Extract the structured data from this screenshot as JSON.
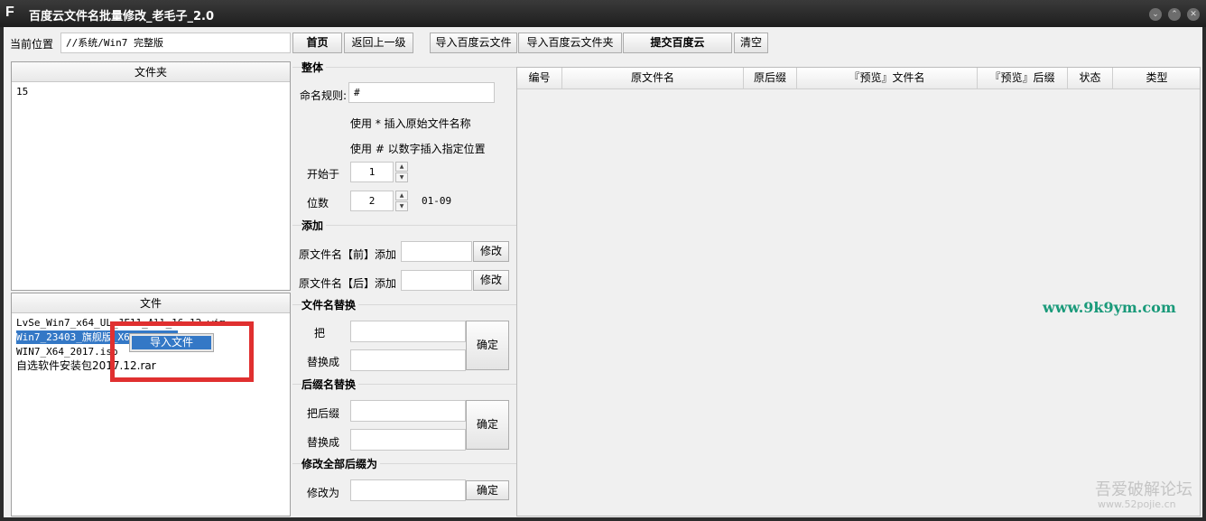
{
  "window": {
    "title": "百度云文件名批量修改_老毛子_2.0",
    "icon": "F",
    "controls": [
      "minimize",
      "maximize",
      "close"
    ]
  },
  "toolbar": {
    "location_label": "当前位置",
    "location_value": "//系统/Win7 完整版",
    "home": "首页",
    "up": "返回上一级",
    "import_file": "导入百度云文件",
    "import_folder": "导入百度云文件夹",
    "submit": "提交百度云",
    "clear": "清空"
  },
  "folders": {
    "header": "文件夹",
    "items": [
      "15"
    ]
  },
  "files": {
    "header": "文件",
    "items": [
      "LvSe_Win7_x64_UL_JF11_All_16.12.wim",
      "Win7_23403_旗舰版_X64_CN.esd",
      "WIN7_X64_2017.iso",
      "自选软件安装包2017.12.rar"
    ],
    "selected_index": 1,
    "context_menu": "导入文件"
  },
  "overall": {
    "title": "整体",
    "rule_label": "命名规则:",
    "rule_value": "#",
    "hint1": "使用 * 插入原始文件名称",
    "hint2": "使用 # 以数字插入指定位置",
    "start_label": "开始于",
    "start_value": "1",
    "digits_label": "位数",
    "digits_value": "2",
    "digits_range": "01-09"
  },
  "add": {
    "title": "添加",
    "before_label": "原文件名【前】添加",
    "after_label": "原文件名【后】添加",
    "modify": "修改"
  },
  "replace_name": {
    "title": "文件名替换",
    "find_label": "把",
    "replace_label": "替换成",
    "confirm": "确定"
  },
  "replace_ext": {
    "title": "后缀名替换",
    "find_label": "把后缀",
    "replace_label": "替换成",
    "confirm": "确定"
  },
  "change_all_ext": {
    "title": "修改全部后缀为",
    "label": "修改为",
    "confirm": "确定"
  },
  "table": {
    "columns": [
      "编号",
      "原文件名",
      "原后缀",
      "『预览』文件名",
      "『预览』后缀",
      "状态",
      "类型"
    ]
  },
  "watermarks": {
    "site": "www.9k9ym.com",
    "forum": "吾爱破解论坛",
    "forum_url": "www.52pojie.cn"
  },
  "colors": {
    "selection": "#3478c6",
    "highlight_box": "#e03030",
    "watermark_green": "#1a9a7a"
  }
}
